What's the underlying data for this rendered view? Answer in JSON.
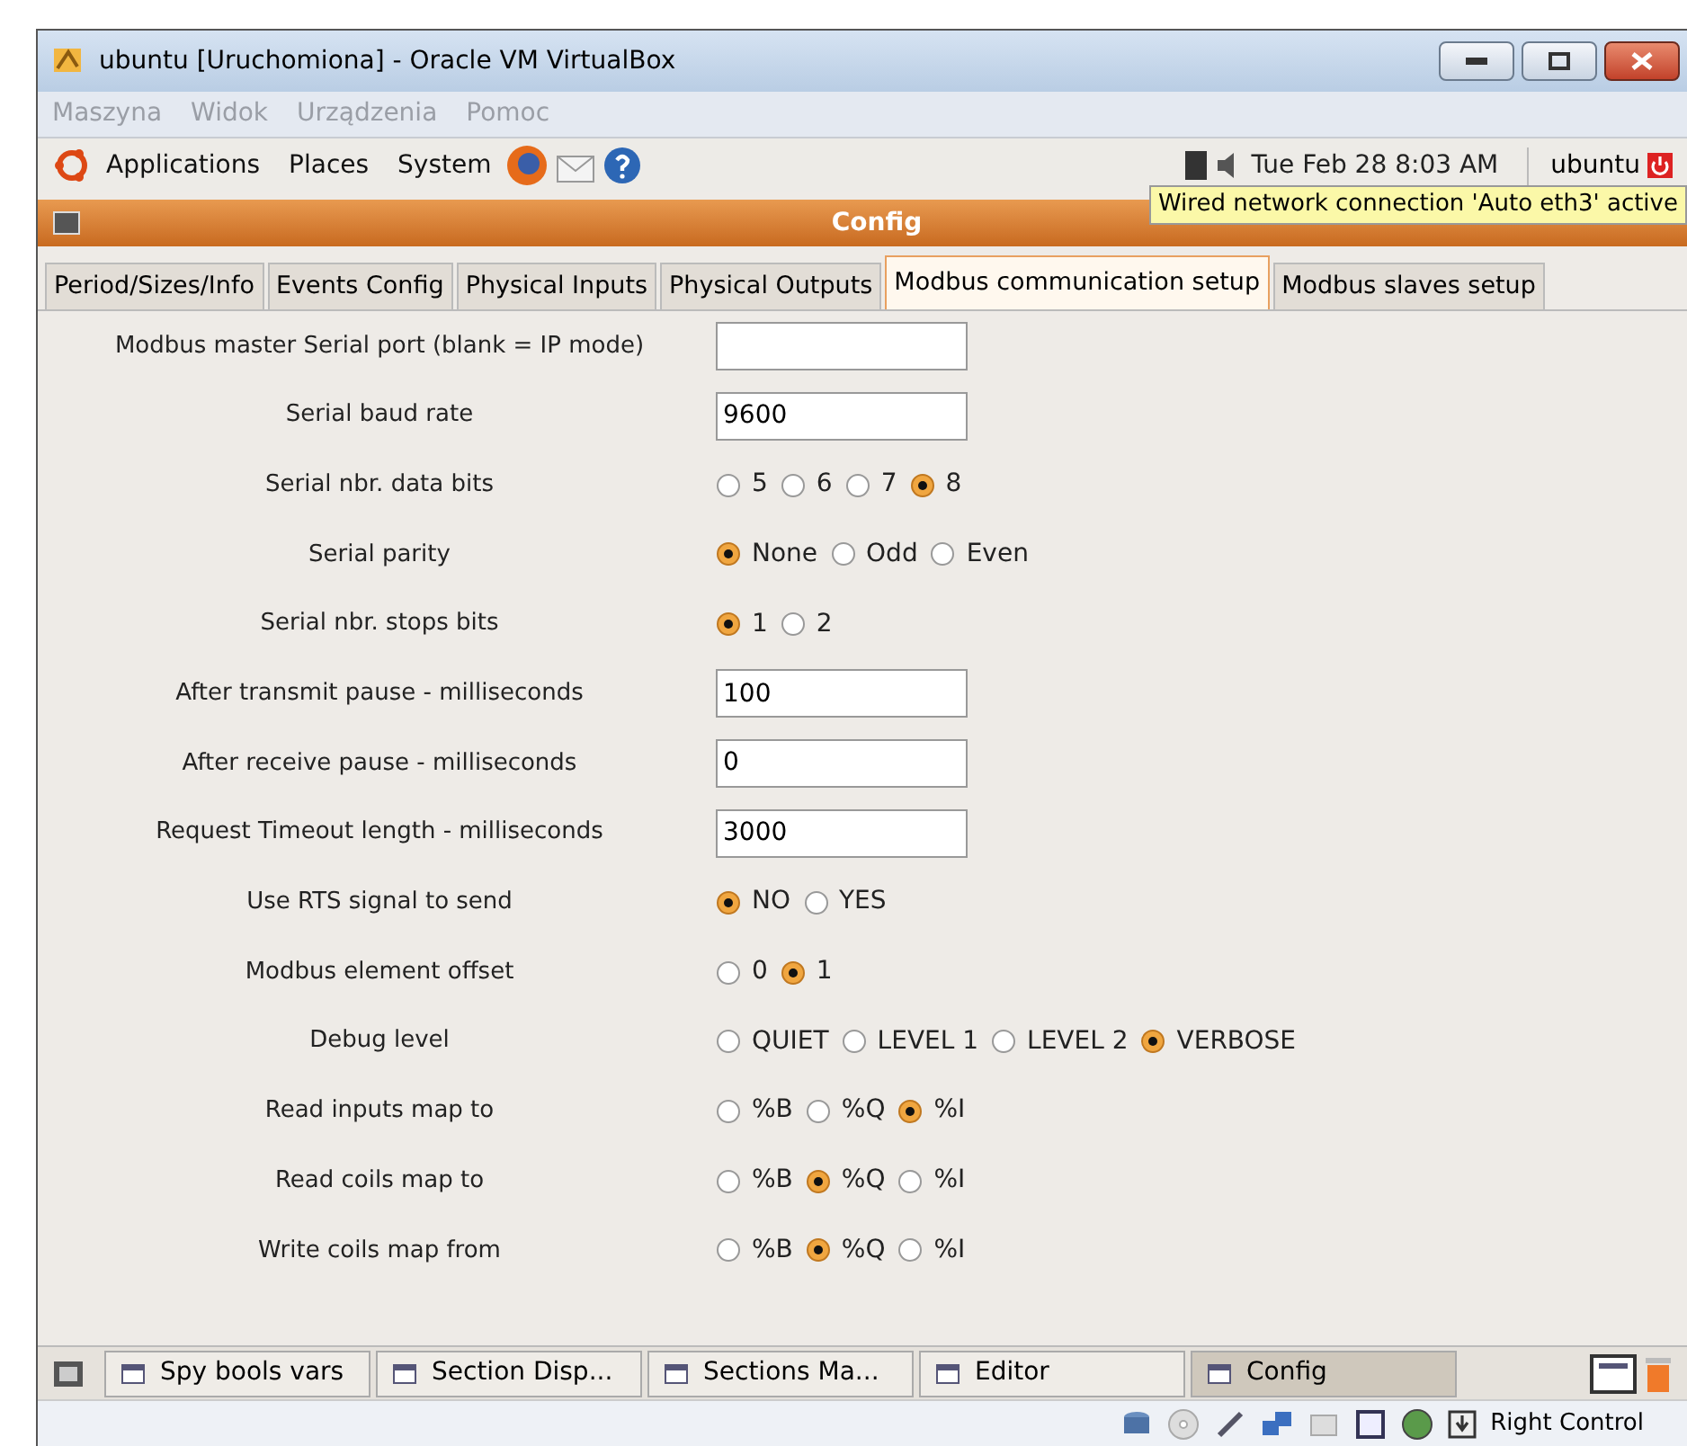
{
  "window": {
    "title": "ubuntu [Uruchomiona] - Oracle VM VirtualBox"
  },
  "menu_bar": [
    "Maszyna",
    "Widok",
    "Urządzenia",
    "Pomoc"
  ],
  "panel": {
    "menus": [
      "Applications",
      "Places",
      "System"
    ],
    "clock": "Tue Feb 28  8:03 AM",
    "user": "ubuntu",
    "tooltip": "Wired network connection 'Auto eth3' active"
  },
  "config_window": {
    "title": "Config"
  },
  "tabs": [
    {
      "label": "Period/Sizes/Info",
      "selected": false
    },
    {
      "label": "Events Config",
      "selected": false
    },
    {
      "label": "Physical Inputs",
      "selected": false
    },
    {
      "label": "Physical Outputs",
      "selected": false
    },
    {
      "label": "Modbus communication setup",
      "selected": true
    },
    {
      "label": "Modbus slaves setup",
      "selected": false
    }
  ],
  "fields": [
    {
      "label": "Modbus master Serial port (blank = IP mode)",
      "kind": "text"
    },
    {
      "label": "Serial baud rate",
      "kind": "text",
      "value": "9600"
    },
    {
      "label": "Serial nbr. data bits",
      "kind": "radio",
      "options": [
        {
          "label": "5",
          "selected": false
        },
        {
          "label": "6",
          "selected": false
        },
        {
          "label": "7",
          "selected": false
        },
        {
          "label": "8",
          "selected": true
        }
      ]
    },
    {
      "label": "Serial parity",
      "kind": "radio",
      "options": [
        {
          "label": "None",
          "selected": true
        },
        {
          "label": "Odd",
          "selected": false
        },
        {
          "label": "Even",
          "selected": false
        }
      ]
    },
    {
      "label": "Serial nbr. stops bits",
      "kind": "radio",
      "options": [
        {
          "label": "1",
          "selected": true
        },
        {
          "label": "2",
          "selected": false
        }
      ]
    },
    {
      "label": "After transmit pause - milliseconds",
      "kind": "text",
      "value": "100"
    },
    {
      "label": "After receive pause - milliseconds",
      "kind": "text",
      "value": "0"
    },
    {
      "label": "Request Timeout length - milliseconds",
      "kind": "text",
      "value": "3000"
    },
    {
      "label": "Use RTS signal to send",
      "kind": "radio",
      "options": [
        {
          "label": "NO",
          "selected": true
        },
        {
          "label": "YES",
          "selected": false
        }
      ]
    },
    {
      "label": "Modbus element offset",
      "kind": "radio",
      "options": [
        {
          "label": "0",
          "selected": false
        },
        {
          "label": "1",
          "selected": true
        }
      ]
    },
    {
      "label": "Debug level",
      "kind": "radio",
      "options": [
        {
          "label": "QUIET",
          "selected": false
        },
        {
          "label": "LEVEL 1",
          "selected": false
        },
        {
          "label": "LEVEL 2",
          "selected": false
        },
        {
          "label": "VERBOSE",
          "selected": true
        }
      ]
    },
    {
      "label": "Read inputs map to",
      "kind": "radio",
      "options": [
        {
          "label": "%B",
          "selected": false
        },
        {
          "label": "%Q",
          "selected": false
        },
        {
          "label": "%I",
          "selected": true
        }
      ]
    },
    {
      "label": "Read coils map to",
      "kind": "radio",
      "options": [
        {
          "label": "%B",
          "selected": false
        },
        {
          "label": "%Q",
          "selected": true
        },
        {
          "label": "%I",
          "selected": false
        }
      ]
    },
    {
      "label": "Write coils map from",
      "kind": "radio",
      "options": [
        {
          "label": "%B",
          "selected": false
        },
        {
          "label": "%Q",
          "selected": true
        },
        {
          "label": "%I",
          "selected": false
        }
      ]
    }
  ],
  "taskbar": [
    {
      "label": "Spy bools vars",
      "selected": false
    },
    {
      "label": "Section Disp...",
      "selected": false
    },
    {
      "label": "Sections Ma...",
      "selected": false
    },
    {
      "label": "Editor",
      "selected": false
    },
    {
      "label": "Config",
      "selected": true
    }
  ],
  "status_bar": {
    "host_key": "Right Control"
  }
}
